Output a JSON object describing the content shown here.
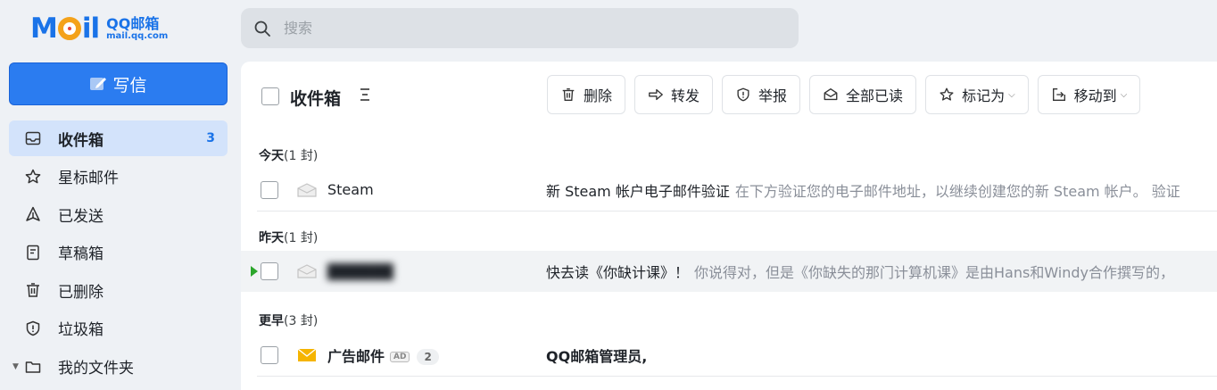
{
  "logo": {
    "brand": "QQ邮箱",
    "domain": "mail.qq.com",
    "mark_left": "M",
    "mark_right": "il"
  },
  "search": {
    "placeholder": "搜索",
    "value": ""
  },
  "compose": {
    "label": "写信"
  },
  "sidebar": {
    "items": [
      {
        "label": "收件箱",
        "icon": "inbox-icon",
        "count": "3",
        "active": true
      },
      {
        "label": "星标邮件",
        "icon": "star-icon"
      },
      {
        "label": "已发送",
        "icon": "sent-icon"
      },
      {
        "label": "草稿箱",
        "icon": "draft-icon"
      },
      {
        "label": "已删除",
        "icon": "trash-icon"
      },
      {
        "label": "垃圾箱",
        "icon": "shield-icon"
      },
      {
        "label": "我的文件夹",
        "icon": "folder-icon",
        "collapsible": true
      }
    ]
  },
  "header": {
    "title": "收件箱"
  },
  "toolbar": {
    "delete": "删除",
    "forward": "转发",
    "report": "举报",
    "mark_all_read": "全部已读",
    "mark_as": "标记为",
    "move_to": "移动到"
  },
  "groups": [
    {
      "label": "今天",
      "count": "(1 封)"
    },
    {
      "label": "昨天",
      "count": "(1 封)"
    },
    {
      "label": "更早",
      "count": "(3 封)"
    }
  ],
  "emails": [
    {
      "sender": "Steam",
      "subject": "新 Steam 帐户电子邮件验证",
      "snippet": "在下方验证您的电子邮件地址，以继续创建您的新 Steam 帐户。 验证"
    },
    {
      "sender": "██████",
      "subject": "快去读《你缺计课》！",
      "snippet": "你说得对，但是《你缺失的那门计算机课》是由Hans和Windy合作撰写的，"
    },
    {
      "sender": "广告邮件",
      "ad_label": "AD",
      "thread_count": "2",
      "subject": "QQ邮箱管理员,",
      "snippet": ""
    }
  ],
  "colors": {
    "accent": "#2b7cf0",
    "active_bg": "#d3e3fb",
    "unread_flag": "#2ba62b",
    "envelope_unread": "#f5b400"
  }
}
